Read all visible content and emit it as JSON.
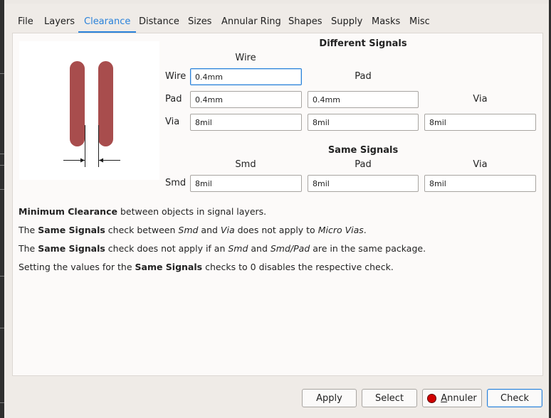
{
  "tabs": [
    "File",
    "Layers",
    "Clearance",
    "Distance",
    "Sizes",
    "Annular Ring",
    "Shapes",
    "Supply",
    "Masks",
    "Misc"
  ],
  "active_tab": "Clearance",
  "different_signals": {
    "title": "Different Signals",
    "col_wire": "Wire",
    "col_pad": "Pad",
    "col_via": "Via",
    "row_wire": "Wire",
    "row_pad": "Pad",
    "row_via": "Via",
    "wire_wire": "0.4mm",
    "pad_wire": "0.4mm",
    "pad_pad": "0.4mm",
    "via_wire": "8mil",
    "via_pad": "8mil",
    "via_via": "8mil"
  },
  "same_signals": {
    "title": "Same Signals",
    "col_smd": "Smd",
    "col_pad": "Pad",
    "col_via": "Via",
    "row_smd": "Smd",
    "smd_smd": "8mil",
    "smd_pad": "8mil",
    "smd_via": "8mil"
  },
  "notes": {
    "n1_b": "Minimum Clearance",
    "n1_t": " between objects in signal layers.",
    "n2_a": "The ",
    "n2_b": "Same Signals",
    "n2_c": " check between ",
    "n2_i1": "Smd",
    "n2_d": " and ",
    "n2_i2": "Via",
    "n2_e": " does not apply to ",
    "n2_i3": "Micro Vias",
    "n2_f": ".",
    "n3_a": "The ",
    "n3_b": "Same Signals",
    "n3_c": " check does not apply if an ",
    "n3_i1": "Smd",
    "n3_d": " and ",
    "n3_i2": "Smd/Pad",
    "n3_e": " are in the same package.",
    "n4_a": "Setting the values for the ",
    "n4_b": "Same Signals",
    "n4_c": " checks to 0 disables the respective check."
  },
  "buttons": {
    "apply": "Apply",
    "select": "Select",
    "annuler_u": "A",
    "annuler_rest": "nnuler",
    "check": "Check"
  },
  "colors": {
    "accent": "#2a82da",
    "pad_fill": "#a84d4d",
    "record_red": "#d00000"
  },
  "icons": {
    "annuler": "record-red-dot-icon"
  }
}
